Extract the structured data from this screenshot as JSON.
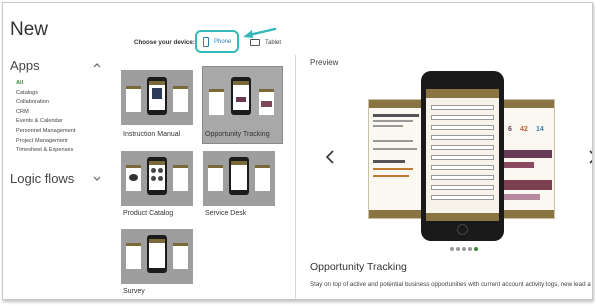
{
  "page": {
    "title": "New"
  },
  "sidebar": {
    "apps_heading": "Apps",
    "logic_heading": "Logic flows",
    "items": [
      {
        "label": "All",
        "active": true
      },
      {
        "label": "Catalogs"
      },
      {
        "label": "Collaboration"
      },
      {
        "label": "CRM"
      },
      {
        "label": "Events & Calendar"
      },
      {
        "label": "Personnel Management"
      },
      {
        "label": "Project Management"
      },
      {
        "label": "Timesheet & Expenses"
      }
    ]
  },
  "device": {
    "prompt": "Choose your device:",
    "phone_label": "Phone",
    "tablet_label": "Tablet",
    "highlight_color": "#36b8b8",
    "selected": "Phone"
  },
  "templates": [
    {
      "label": "Instruction Manual"
    },
    {
      "label": "Opportunity Tracking",
      "selected": true
    },
    {
      "label": "Product Catalog"
    },
    {
      "label": "Service Desk"
    },
    {
      "label": "Survey"
    }
  ],
  "preview": {
    "label": "Preview",
    "title": "Opportunity Tracking",
    "description": "Stay on top of active and potential business opportunities with current account activity logs, new lead a",
    "stats": [
      "6",
      "42",
      "14"
    ],
    "dot_count": 5,
    "active_dot": 4
  },
  "colors": {
    "accent_green": "#3a8a3a",
    "brand_gold": "#8a7442",
    "link_blue": "#2a7fb5"
  }
}
